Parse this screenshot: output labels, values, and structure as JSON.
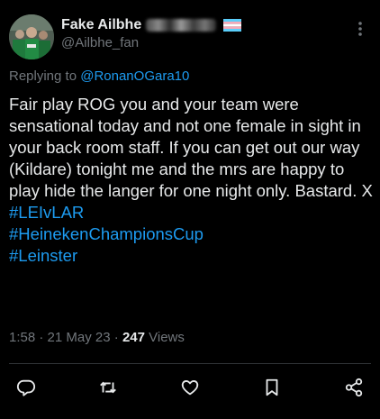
{
  "tweet": {
    "display_name": "Fake Ailbhe",
    "handle": "@Ailbhe_fan",
    "replying_prefix": "Replying to ",
    "replying_to": "@RonanOGara10",
    "body": "Fair play ROG you and your team were sensational today and not one female in sight in your back room staff.  If you can get out our way (Kildare) tonight me and the mrs are happy to play hide the langer for one night only.  Bastard. X",
    "hashtags": [
      "#LEIvLAR",
      "#HeinekenChampionsCup",
      "#Leinster"
    ],
    "time": "1:58",
    "sep1": " · ",
    "date": "21 May 23",
    "sep2": " · ",
    "views_count": "247",
    "views_label": " Views"
  },
  "colors": {
    "background": "#000000",
    "text": "#e7e9ea",
    "secondary": "#71767b",
    "link": "#1d9bf0",
    "divider": "#2f3336"
  },
  "icons": {
    "more": "more-dots-icon",
    "flag": "transgender-flag-icon",
    "reply": "reply-icon",
    "retweet": "retweet-icon",
    "like": "heart-icon",
    "bookmark": "bookmark-icon",
    "share": "share-icon"
  }
}
